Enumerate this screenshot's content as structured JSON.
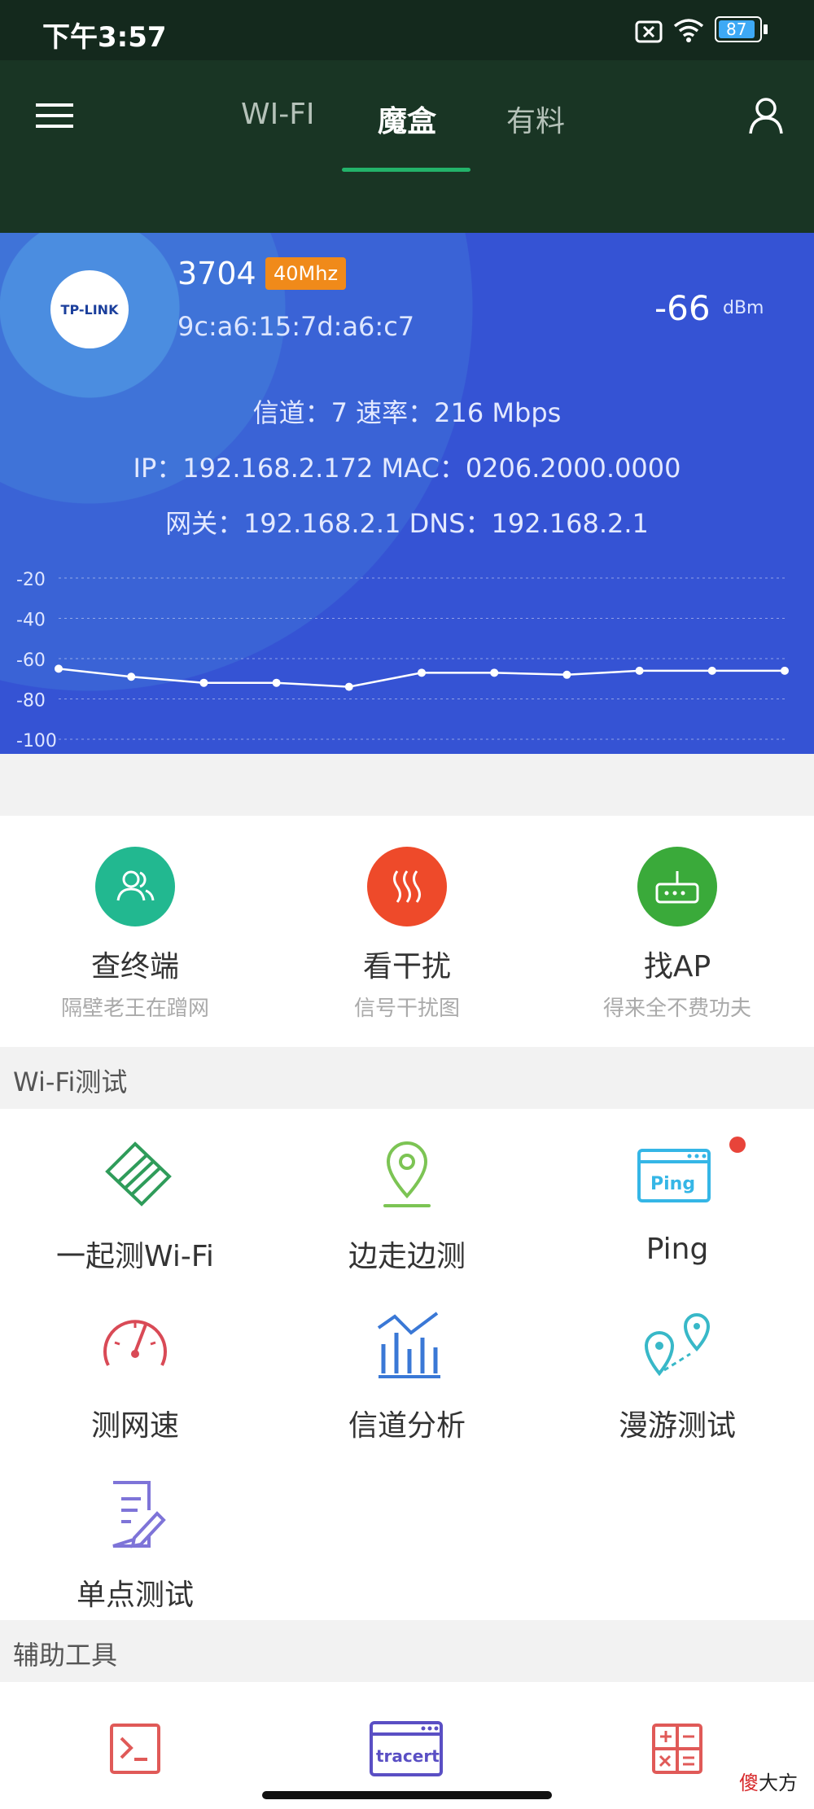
{
  "status_bar": {
    "time": "下午3:57",
    "battery": "87"
  },
  "nav": {
    "tabs": [
      "WI-FI",
      "魔盒",
      "有料"
    ],
    "active_tab": "魔盒"
  },
  "wifi": {
    "logo": "TP-LINK",
    "ssid": "3704",
    "band": "40Mhz",
    "bssid": "9c:a6:15:7d:a6:c7",
    "rssi": "-66",
    "rssi_unit": "dBm",
    "channel_line": "信道：7  速率：216 Mbps",
    "ip_line": "IP：192.168.2.172  MAC：0206.2000.0000",
    "gateway_line": "网关：192.168.2.1  DNS：192.168.2.1"
  },
  "chart_data": {
    "type": "line",
    "y_ticks": [
      "-20",
      "-40",
      "-60",
      "-80",
      "-100"
    ],
    "ylim": [
      -100,
      -20
    ],
    "series": [
      {
        "values": [
          -65,
          -69,
          -72,
          -72,
          -74,
          -67,
          -67,
          -68,
          -66,
          -66,
          -66
        ]
      }
    ],
    "grid": true
  },
  "features": [
    {
      "title": "查终端",
      "sub": "隔壁老王在蹭网",
      "color": "#22b890"
    },
    {
      "title": "看干扰",
      "sub": "信号干扰图",
      "color": "#ee4a2a"
    },
    {
      "title": "找AP",
      "sub": "得来全不费功夫",
      "color": "#3aaa3a"
    }
  ],
  "sections": {
    "wifi_test": "Wi-Fi测试",
    "tools": "辅助工具"
  },
  "wifi_tests": [
    {
      "label": "一起测Wi-Fi",
      "icon": "handshake-icon"
    },
    {
      "label": "边走边测",
      "icon": "location-pin-icon"
    },
    {
      "label": "Ping",
      "icon": "ping-window-icon",
      "icon_text": "Ping"
    },
    {
      "label": "测网速",
      "icon": "speedometer-icon"
    },
    {
      "label": "信道分析",
      "icon": "bar-chart-icon"
    },
    {
      "label": "漫游测试",
      "icon": "roaming-pins-icon"
    },
    {
      "label": "单点测试",
      "icon": "document-edit-icon"
    }
  ],
  "tools": [
    {
      "icon": "terminal-icon"
    },
    {
      "icon": "tracert-icon",
      "icon_text": "tracert"
    },
    {
      "icon": "calculator-icon"
    }
  ],
  "watermark": {
    "first": "傻",
    "rest": "大方"
  }
}
